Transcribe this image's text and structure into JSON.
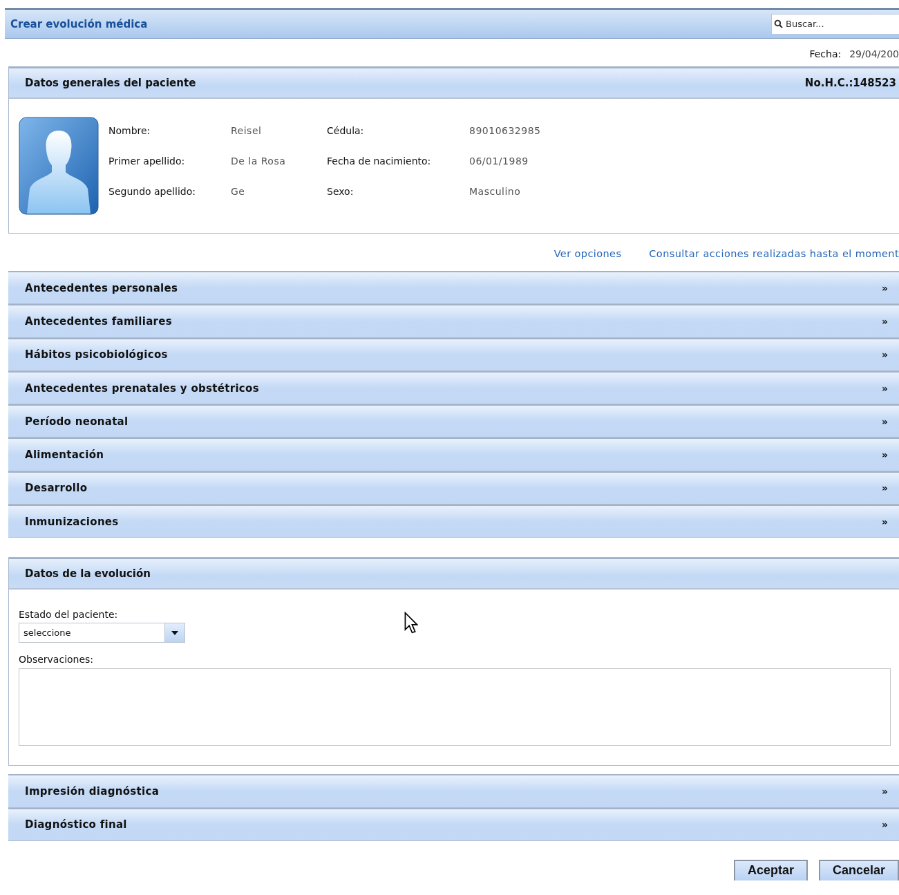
{
  "window": {
    "title": "Crear evolución médica"
  },
  "search": {
    "placeholder": "Buscar..."
  },
  "date": {
    "label": "Fecha:",
    "value": "29/04/200"
  },
  "patient_panel": {
    "title": "Datos generales del paciente",
    "record_number": "No.H.C.:148523",
    "fields": [
      {
        "label": "Nombre:",
        "value": "Reisel"
      },
      {
        "label": "Cédula:",
        "value": "89010632985"
      },
      {
        "label": "Primer apellido:",
        "value": "De la Rosa"
      },
      {
        "label": "Fecha de nacimiento:",
        "value": "06/01/1989"
      },
      {
        "label": "Segundo apellido:",
        "value": "Ge"
      },
      {
        "label": "Sexo:",
        "value": "Masculino"
      }
    ]
  },
  "links": [
    "Ver opciones",
    "Consultar acciones realizadas hasta el moment"
  ],
  "sections": [
    {
      "title": "Antecedentes personales",
      "toggle": "»"
    },
    {
      "title": "Antecedentes familiares",
      "toggle": "»"
    },
    {
      "title": "Hábitos psicobiológicos",
      "toggle": "»"
    },
    {
      "title": "Antecedentes prenatales y obstétricos",
      "toggle": "»"
    },
    {
      "title": "Período neonatal",
      "toggle": "»"
    },
    {
      "title": "Alimentación",
      "toggle": "»"
    },
    {
      "title": "Desarrollo",
      "toggle": "»"
    },
    {
      "title": "Inmunizaciones",
      "toggle": "»"
    }
  ],
  "evolution_panel": {
    "title": "Datos de la evolución",
    "status_label": "Estado del paciente:",
    "status_value": "seleccione",
    "notes_label": "Observaciones:"
  },
  "diagnosis_sections": [
    {
      "title": "Impresión diagnóstica",
      "toggle": "»"
    },
    {
      "title": "Diagnóstico final",
      "toggle": "»"
    }
  ],
  "buttons": [
    "Aceptar",
    "Cancelar"
  ]
}
